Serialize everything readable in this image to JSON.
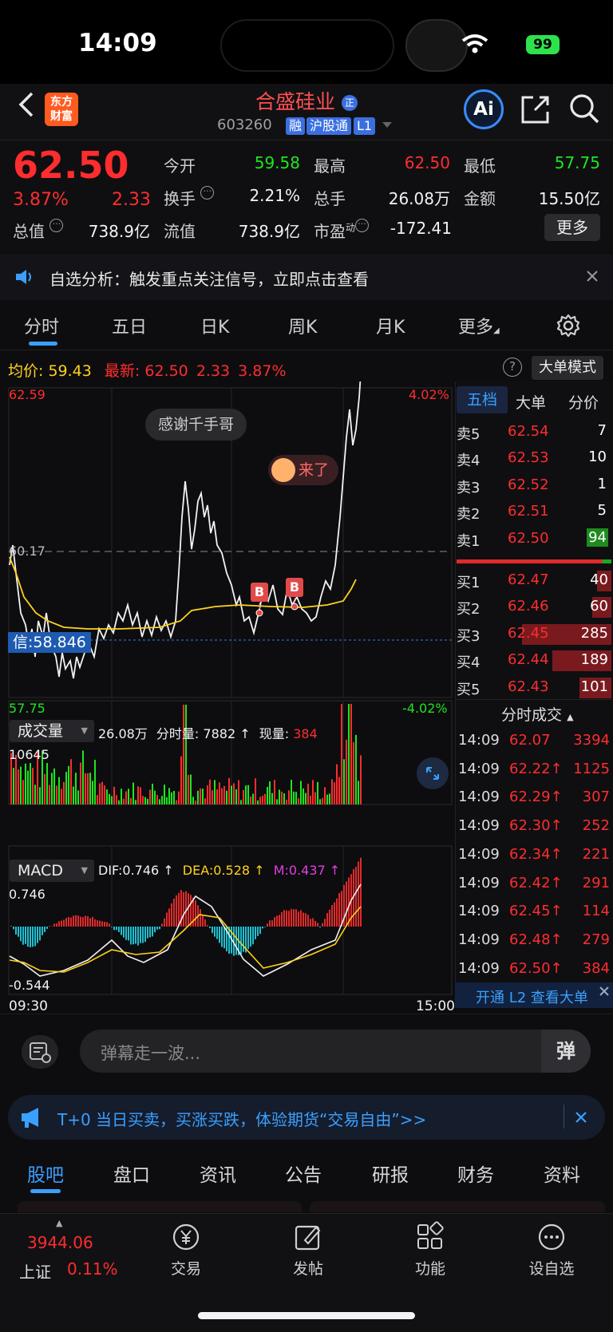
{
  "status": {
    "time": "14:09",
    "battery": "99"
  },
  "header": {
    "app_logo": "东方财富",
    "stock_name": "合盛硅业",
    "name_badge": "正",
    "stock_code": "603260",
    "tags": [
      "融",
      "沪股通",
      "L1"
    ],
    "icons": [
      "back-icon",
      "ai-icon",
      "share-icon",
      "search-icon"
    ],
    "ai_label": "Ai"
  },
  "quote": {
    "price": "62.50",
    "change_pct": "3.87%",
    "change": "2.33",
    "open_label": "今开",
    "open": "59.58",
    "high_label": "最高",
    "high": "62.50",
    "low_label": "最低",
    "low": "57.75",
    "turnover_label": "换手",
    "turnover": "2.21%",
    "volume_label": "总手",
    "volume": "26.08万",
    "amount_label": "金额",
    "amount": "15.50亿",
    "mcap_label": "总值",
    "mcap": "738.9亿",
    "float_label": "流值",
    "float": "738.9亿",
    "pe_label": "市盈",
    "pe_sup": "动",
    "pe": "-172.41",
    "more_button": "更多"
  },
  "notice": {
    "text": "自选分析：触发重点关注信号，立即点击查看"
  },
  "period_tabs": [
    "分时",
    "五日",
    "日K",
    "周K",
    "月K",
    "更多"
  ],
  "active_period_tab": "分时",
  "chart_info": {
    "avg_label": "均价:",
    "avg": "59.43",
    "latest_label": "最新:",
    "latest": "62.50",
    "latest_change": "2.33",
    "latest_pct": "3.87%",
    "big_order_mode": "大单模式"
  },
  "price_chart": {
    "top_price": "62.59",
    "mid_price": "60.17",
    "bottom_price": "57.75",
    "top_pct": "4.02%",
    "bottom_pct": "-4.02%",
    "cursor_label": "信:58.846",
    "danmaku1": "感谢千手哥",
    "danmaku2": "来了",
    "buy_marker": "B"
  },
  "volume_panel": {
    "label": "成交量",
    "total": "26.08万",
    "per_minute_label": "分时量:",
    "per_minute": "7882",
    "current_label": "现量:",
    "current": "384",
    "max": "10645"
  },
  "macd_panel": {
    "label": "MACD",
    "dif_label": "DIF:",
    "dif": "0.746",
    "dea_label": "DEA:",
    "dea": "0.528",
    "m_label": "M:",
    "m": "0.437",
    "max": "0.746",
    "min": "-0.544",
    "time_start": "09:30",
    "time_end": "15:00"
  },
  "orderbook": {
    "tabs": [
      "五档",
      "大单",
      "分价"
    ],
    "asks": [
      {
        "label": "卖5",
        "price": "62.54",
        "vol": "7"
      },
      {
        "label": "卖4",
        "price": "62.53",
        "vol": "10"
      },
      {
        "label": "卖3",
        "price": "62.52",
        "vol": "1"
      },
      {
        "label": "卖2",
        "price": "62.51",
        "vol": "5"
      },
      {
        "label": "卖1",
        "price": "62.50",
        "vol": "94"
      }
    ],
    "bids": [
      {
        "label": "买1",
        "price": "62.47",
        "vol": "40"
      },
      {
        "label": "买2",
        "price": "62.46",
        "vol": "60"
      },
      {
        "label": "买3",
        "price": "62.45",
        "vol": "285"
      },
      {
        "label": "买4",
        "price": "62.44",
        "vol": "189"
      },
      {
        "label": "买5",
        "price": "62.43",
        "vol": "101"
      }
    ],
    "trades_title": "分时成交",
    "trades": [
      {
        "time": "14:09",
        "price": "62.07",
        "vol": "3394"
      },
      {
        "time": "14:09",
        "price": "62.22↑",
        "vol": "1125"
      },
      {
        "time": "14:09",
        "price": "62.29↑",
        "vol": "307"
      },
      {
        "time": "14:09",
        "price": "62.30↑",
        "vol": "252"
      },
      {
        "time": "14:09",
        "price": "62.34↑",
        "vol": "221"
      },
      {
        "time": "14:09",
        "price": "62.42↑",
        "vol": "291"
      },
      {
        "time": "14:09",
        "price": "62.45↑",
        "vol": "114"
      },
      {
        "time": "14:09",
        "price": "62.48↑",
        "vol": "279"
      },
      {
        "time": "14:09",
        "price": "62.50↑",
        "vol": "384"
      }
    ],
    "l2_banner": "开通 L2 查看大单"
  },
  "danmaku_input": {
    "placeholder": "弹幕走一波...",
    "send_label": "弹"
  },
  "promo": {
    "text": "T+0 当日买卖，买涨买跌，体验期货“交易自由”>>"
  },
  "bottom_tabs": [
    "股吧",
    "盘口",
    "资讯",
    "公告",
    "研报",
    "财务",
    "资料"
  ],
  "dock": {
    "index_value": "3944.06",
    "index_name": "上证",
    "index_pct": "0.11%",
    "items": [
      "交易",
      "发帖",
      "功能",
      "设自选"
    ]
  },
  "colors": {
    "up": "#ff2d2d",
    "down": "#1ee61e",
    "avg_line": "#ffd21a",
    "accent": "#3aa0ff"
  }
}
